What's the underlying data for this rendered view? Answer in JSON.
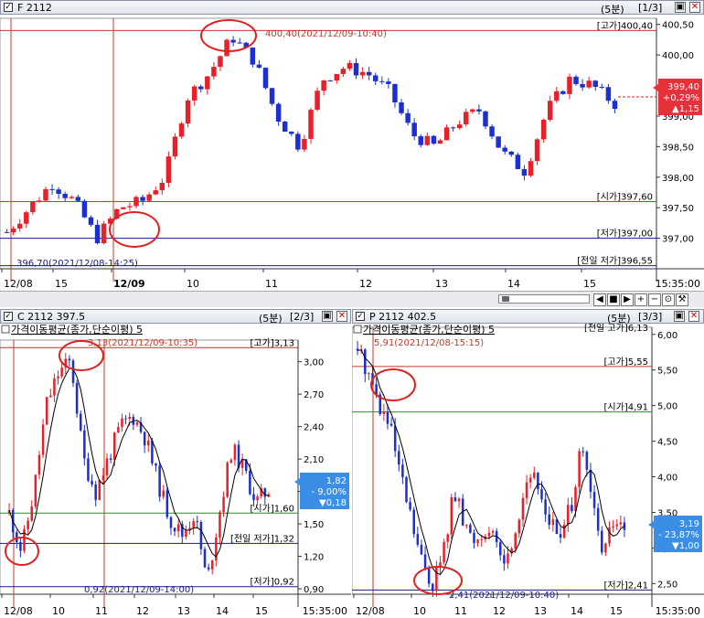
{
  "panels": [
    {
      "id": "f",
      "title": "F 2112",
      "period": "(5분)",
      "page": "[1/3]",
      "indicator": "",
      "x": [
        "12/08",
        "15",
        "12/09",
        "10",
        "11",
        "12",
        "13",
        "14",
        "15"
      ],
      "yticks": [
        "400,50",
        "400,00",
        "399,50",
        "399,00",
        "398,50",
        "398,00",
        "397,50",
        "397,00"
      ],
      "ymin": 396.5,
      "ymax": 400.6,
      "levels": [
        {
          "label": "[고가]400,40",
          "value": 400.4,
          "color": "#c0392b"
        },
        {
          "label": "[시가]397,60",
          "value": 397.6,
          "color": "#2e8b2e"
        },
        {
          "label": "[저가]397,00",
          "value": 397.0,
          "color": "#1a1a8c"
        },
        {
          "label": "[전일 저가]396,55",
          "value": 396.55,
          "color": "#1a1a8c"
        }
      ],
      "high_note": "400,40(2021/12/09-10:40)",
      "low_note": "396,70(2021/12/08-14:25)",
      "badge": {
        "price": "399,40",
        "pct": "+0,29%",
        "chg": "▲1,15"
      },
      "time_axis_end": "15:35:00"
    },
    {
      "id": "c",
      "title": "C 2112 397.5",
      "period": "(5분)",
      "page": "[2/3]",
      "indicator": "가격이동평균(종가,단순이평) 5",
      "x": [
        "12/08",
        "10",
        "11",
        "12",
        "13",
        "14",
        "15"
      ],
      "yticks": [
        "3,00",
        "2,70",
        "2,40",
        "2,10",
        "1,80",
        "1,50",
        "1,20",
        "0,90"
      ],
      "ymin": 0.85,
      "ymax": 3.2,
      "levels": [
        {
          "label": "[고가]3,13",
          "value": 3.13,
          "color": "#c0392b"
        },
        {
          "label": "[시가]1,60",
          "value": 1.6,
          "color": "#2e8b2e"
        },
        {
          "label": "[전일 저가]1,32",
          "value": 1.32,
          "color": "#1a1a8c"
        },
        {
          "label": "[저가]0,92",
          "value": 0.92,
          "color": "#1a1a8c"
        }
      ],
      "high_note": "3,13(2021/12/09-10:35)",
      "low_note": "0,92(2021/12/09-14:00)",
      "badge": {
        "price": "1,82",
        "pct": "- 9,00%",
        "chg": "▼0,18"
      },
      "time_axis_end": "15:35:00"
    },
    {
      "id": "p",
      "title": "P 2112 402.5",
      "period": "(5분)",
      "page": "[3/3]",
      "indicator": "가격이동평균(종가,단순이평) 5",
      "x": [
        "12/08",
        "10",
        "11",
        "12",
        "13",
        "14",
        "15"
      ],
      "yticks": [
        "6,00",
        "5,50",
        "5,00",
        "4,50",
        "4,00",
        "3,50",
        "3,00",
        "2,50"
      ],
      "ymin": 2.35,
      "ymax": 6.1,
      "levels": [
        {
          "label": "[고가]5,55",
          "value": 5.55,
          "color": "#c0392b"
        },
        {
          "label": "[시가]4,91",
          "value": 4.91,
          "color": "#2e8b2e"
        },
        {
          "label": "[저가]2,41",
          "value": 2.41,
          "color": "#1a1a8c"
        }
      ],
      "top_partial": "[전일 고가]6,13",
      "high_note": "5,91(2021/12/08-15:15)",
      "low_note": "2,41(2021/12/09-10:40)",
      "badge": {
        "price": "3,19",
        "pct": "- 23,87%",
        "chg": "▼1,00"
      },
      "time_axis_end": "15:35:00"
    }
  ],
  "colors": {
    "up": "#e8202a",
    "down": "#1c2fd0",
    "ma": "#000000",
    "badge_up": "#e8303a",
    "badge_down": "#3a8ee6"
  },
  "icons": [
    "zoom-in-icon",
    "zoom-out-icon",
    "zoom-reset-icon",
    "settings-wrench-icon",
    "prev-icon",
    "stop-icon",
    "next-icon",
    "first-icon"
  ]
}
